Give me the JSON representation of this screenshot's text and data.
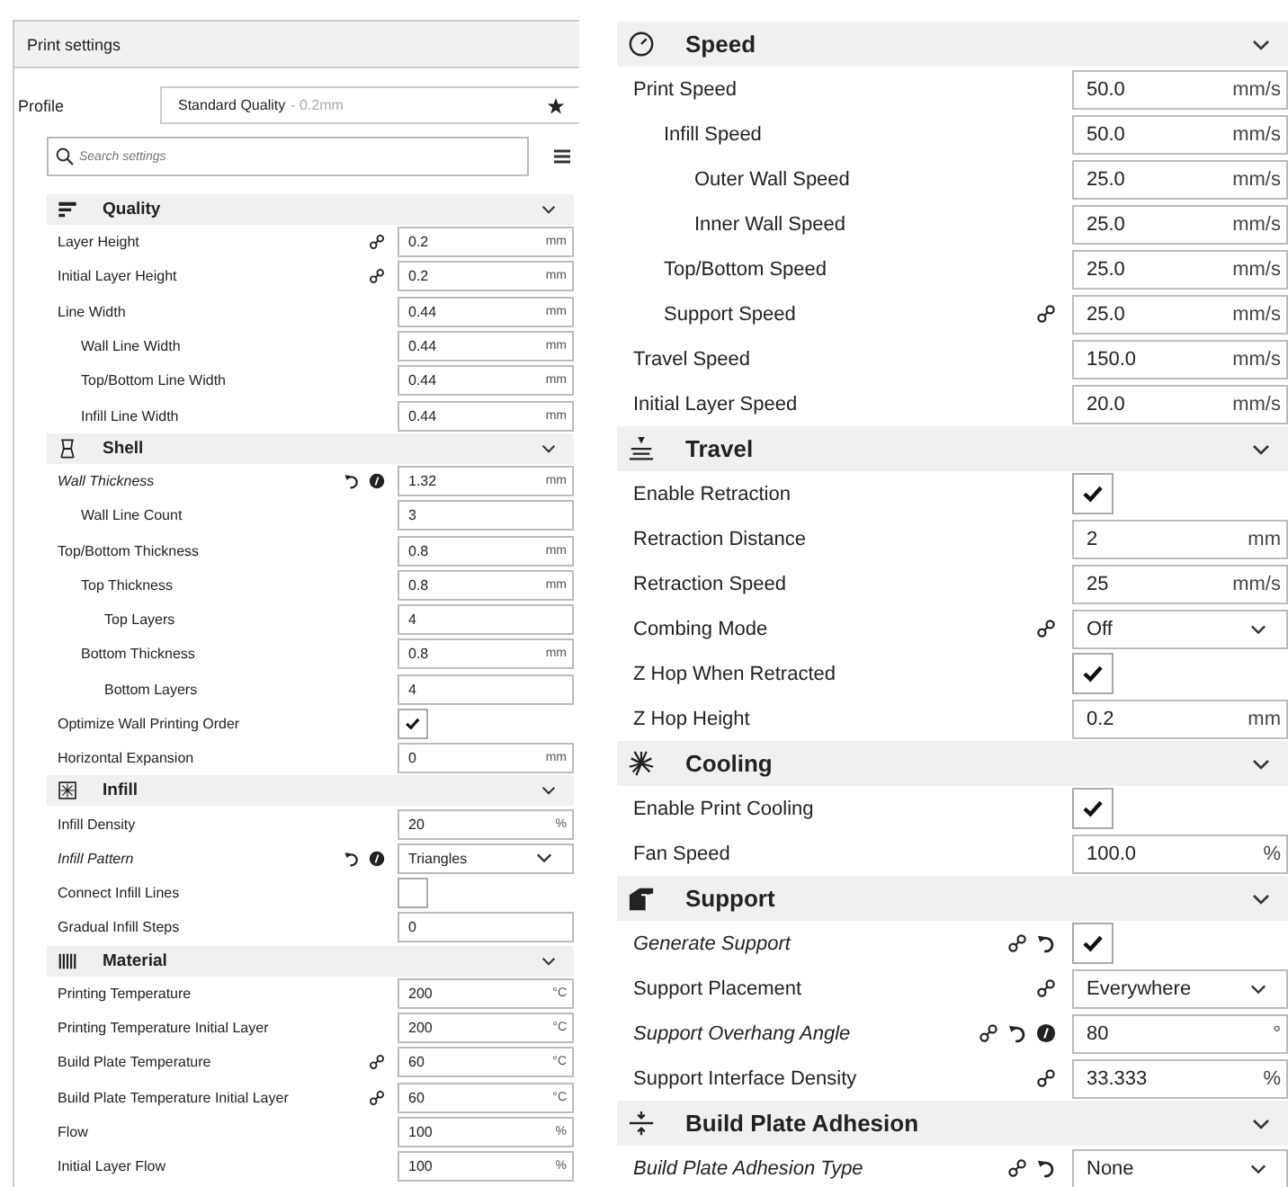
{
  "panel_title": "Print settings",
  "profile": {
    "label": "Profile",
    "value": "Standard Quality",
    "detail": "- 0.2mm"
  },
  "search": {
    "placeholder": "Search settings"
  },
  "left_sections": [
    {
      "title": "Quality",
      "kind": "quality",
      "expanded": true,
      "rows": [
        {
          "label": "Layer Height",
          "kind": "number",
          "value": "0.2",
          "unit": "mm",
          "badges": [
            {
              "kind": "link"
            }
          ]
        },
        {
          "label": "Initial Layer Height",
          "kind": "number",
          "value": "0.2",
          "unit": "mm",
          "badges": [
            {
              "kind": "link"
            }
          ]
        },
        {
          "label": "Line Width",
          "kind": "number",
          "value": "0.44",
          "unit": "mm",
          "children": [
            {
              "label": "Wall Line Width",
              "kind": "number",
              "value": "0.44",
              "unit": "mm"
            },
            {
              "label": "Top/Bottom Line Width",
              "kind": "number",
              "value": "0.44",
              "unit": "mm"
            },
            {
              "label": "Infill Line Width",
              "kind": "number",
              "value": "0.44",
              "unit": "mm"
            }
          ]
        }
      ]
    },
    {
      "title": "Shell",
      "kind": "shell",
      "expanded": true,
      "rows": [
        {
          "label": "Wall Thickness",
          "kind": "number",
          "value": "1.32",
          "unit": "mm",
          "badges": [
            {
              "kind": "reset"
            },
            {
              "kind": "formula"
            }
          ],
          "children": [
            {
              "label": "Wall Line Count",
              "kind": "number",
              "value": "3"
            }
          ]
        },
        {
          "label": "Top/Bottom Thickness",
          "kind": "number",
          "value": "0.8",
          "unit": "mm",
          "children": [
            {
              "label": "Top Thickness",
              "kind": "number",
              "value": "0.8",
              "unit": "mm",
              "children": [
                {
                  "label": "Top Layers",
                  "kind": "number",
                  "value": "4"
                }
              ]
            },
            {
              "label": "Bottom Thickness",
              "kind": "number",
              "value": "0.8",
              "unit": "mm",
              "children": [
                {
                  "label": "Bottom Layers",
                  "kind": "number",
                  "value": "4"
                }
              ]
            }
          ]
        },
        {
          "label": "Optimize Wall Printing Order",
          "kind": "check",
          "checked": true
        },
        {
          "label": "Horizontal Expansion",
          "kind": "number",
          "value": "0",
          "unit": "mm"
        }
      ]
    },
    {
      "title": "Infill",
      "kind": "infill",
      "expanded": true,
      "rows": [
        {
          "label": "Infill Density",
          "kind": "number",
          "value": "20",
          "unit": "%"
        },
        {
          "label": "Infill Pattern",
          "kind": "select",
          "value": "Triangles",
          "badges": [
            {
              "kind": "reset"
            },
            {
              "kind": "formula"
            }
          ]
        },
        {
          "label": "Connect Infill Lines",
          "kind": "check",
          "checked": false
        },
        {
          "label": "Gradual Infill Steps",
          "kind": "number",
          "value": "0"
        }
      ]
    },
    {
      "title": "Material",
      "kind": "material",
      "expanded": true,
      "rows": [
        {
          "label": "Printing Temperature",
          "kind": "number",
          "value": "200",
          "unit": "°C"
        },
        {
          "label": "Printing Temperature Initial Layer",
          "kind": "number",
          "value": "200",
          "unit": "°C"
        },
        {
          "label": "Build Plate Temperature",
          "kind": "number",
          "value": "60",
          "unit": "°C",
          "badges": [
            {
              "kind": "link"
            }
          ]
        },
        {
          "label": "Build Plate Temperature Initial Layer",
          "kind": "number",
          "value": "60",
          "unit": "°C",
          "badges": [
            {
              "kind": "link"
            }
          ]
        },
        {
          "label": "Flow",
          "kind": "number",
          "value": "100",
          "unit": "%"
        },
        {
          "label": "Initial Layer Flow",
          "kind": "number",
          "value": "100",
          "unit": "%"
        }
      ]
    }
  ],
  "right_sections": [
    {
      "title": "Speed",
      "kind": "speed",
      "expanded": true,
      "rows": [
        {
          "label": "Print Speed",
          "kind": "number",
          "value": "50.0",
          "unit": "mm/s",
          "children": [
            {
              "label": "Infill Speed",
              "kind": "number",
              "value": "50.0",
              "unit": "mm/s",
              "children": [
                {
                  "label": "Outer Wall Speed",
                  "kind": "number",
                  "value": "25.0",
                  "unit": "mm/s"
                },
                {
                  "label": "Inner Wall Speed",
                  "kind": "number",
                  "value": "25.0",
                  "unit": "mm/s"
                }
              ]
            },
            {
              "label": "Top/Bottom Speed",
              "kind": "number",
              "value": "25.0",
              "unit": "mm/s"
            },
            {
              "label": "Support Speed",
              "kind": "number",
              "value": "25.0",
              "unit": "mm/s",
              "badges": [
                {
                  "kind": "link"
                }
              ]
            }
          ]
        },
        {
          "label": "Travel Speed",
          "kind": "number",
          "value": "150.0",
          "unit": "mm/s"
        },
        {
          "label": "Initial Layer Speed",
          "kind": "number",
          "value": "20.0",
          "unit": "mm/s"
        }
      ]
    },
    {
      "title": "Travel",
      "kind": "travel",
      "expanded": true,
      "rows": [
        {
          "label": "Enable Retraction",
          "kind": "check",
          "checked": true
        },
        {
          "label": "Retraction Distance",
          "kind": "number",
          "value": "2",
          "unit": "mm"
        },
        {
          "label": "Retraction Speed",
          "kind": "number",
          "value": "25",
          "unit": "mm/s"
        },
        {
          "label": "Combing Mode",
          "kind": "select",
          "value": "Off",
          "badges": [
            {
              "kind": "link"
            }
          ]
        },
        {
          "label": "Z Hop When Retracted",
          "kind": "check",
          "checked": true
        },
        {
          "label": "Z Hop Height",
          "kind": "number",
          "value": "0.2",
          "unit": "mm"
        }
      ]
    },
    {
      "title": "Cooling",
      "kind": "cooling",
      "expanded": true,
      "rows": [
        {
          "label": "Enable Print Cooling",
          "kind": "check",
          "checked": true
        },
        {
          "label": "Fan Speed",
          "kind": "number",
          "value": "100.0",
          "unit": "%"
        }
      ]
    },
    {
      "title": "Support",
      "kind": "support",
      "expanded": true,
      "rows": [
        {
          "label": "Generate Support",
          "kind": "check",
          "checked": true,
          "badges": [
            {
              "kind": "link"
            },
            {
              "kind": "reset"
            }
          ]
        },
        {
          "label": "Support Placement",
          "kind": "select",
          "value": "Everywhere",
          "badges": [
            {
              "kind": "link"
            }
          ]
        },
        {
          "label": "Support Overhang Angle",
          "kind": "number",
          "value": "80",
          "unit": "°",
          "badges": [
            {
              "kind": "link"
            },
            {
              "kind": "reset"
            },
            {
              "kind": "formula"
            }
          ]
        },
        {
          "label": "Support Interface Density",
          "kind": "number",
          "value": "33.333",
          "unit": "%",
          "badges": [
            {
              "kind": "link"
            }
          ]
        }
      ]
    },
    {
      "title": "Build Plate Adhesion",
      "kind": "adhesion",
      "expanded": true,
      "rows": [
        {
          "label": "Build Plate Adhesion Type",
          "kind": "select",
          "value": "None",
          "badges": [
            {
              "kind": "link"
            },
            {
              "kind": "reset"
            }
          ]
        }
      ]
    }
  ]
}
